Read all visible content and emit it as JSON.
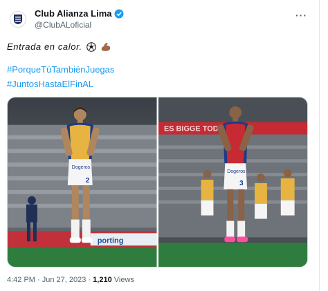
{
  "account": {
    "display_name": "Club Alianza Lima",
    "handle": "@ClubALoficial",
    "verified": true
  },
  "tweet": {
    "body": "Entrada en calor.",
    "emojis": [
      "soccer-ball-icon",
      "flexed-biceps-icon"
    ],
    "hashtags": [
      "#PorqueTúTambiénJuegas",
      "#JuntosHastaElFinAL"
    ]
  },
  "photos": [
    {
      "shirt_number": "2",
      "sponsor": "Dogeros",
      "board": "porting"
    },
    {
      "shirt_number": "3",
      "sponsor": "Dogeros",
      "banner": "ES  BIGGE  TODA"
    }
  ],
  "meta": {
    "time": "4:42 PM",
    "separator": " · ",
    "date": "Jun 27, 2023",
    "views_count": "1,210",
    "views_label": "Views"
  },
  "colors": {
    "link": "#1d9bf0",
    "secondary_text": "#536471",
    "verified": "#1d9bf0"
  }
}
